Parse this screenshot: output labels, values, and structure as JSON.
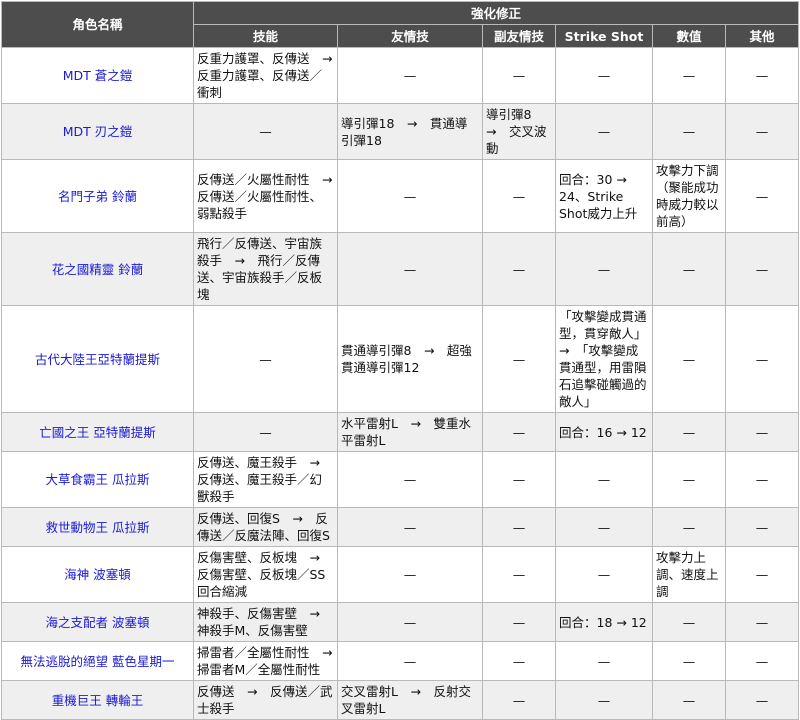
{
  "headers": {
    "name": "角色名稱",
    "group": "強化修正",
    "skill": "技能",
    "friend": "友情技",
    "sub_friend": "副友情技",
    "strike_shot": "Strike Shot",
    "stats": "數值",
    "other": "其他"
  },
  "rows": [
    {
      "name": "MDT 蒼之鎧",
      "skill": "反重力護罩、反傳送　→　反重力護罩、反傳送／衝刺",
      "friend": "—",
      "sub_friend": "—",
      "strike_shot": "—",
      "stats": "—",
      "other": "—"
    },
    {
      "name": "MDT 刃之鎧",
      "skill": "—",
      "friend": "導引彈18　→　貫通導引彈18",
      "sub_friend": "導引彈8　→　交叉波動",
      "strike_shot": "—",
      "stats": "—",
      "other": "—"
    },
    {
      "name": "名門子弟 鈴蘭",
      "skill": "反傳送／火屬性耐性　→　反傳送／火屬性耐性、弱點殺手",
      "friend": "—",
      "sub_friend": "—",
      "strike_shot": "回合：30 → 24、Strike Shot威力上升",
      "stats": "攻擊力下調（聚能成功時威力較以前高）",
      "other": "—"
    },
    {
      "name": "花之國精靈 鈴蘭",
      "skill": "飛行／反傳送、宇宙族殺手　→　飛行／反傳送、宇宙族殺手／反板塊",
      "friend": "—",
      "sub_friend": "—",
      "strike_shot": "—",
      "stats": "—",
      "other": "—"
    },
    {
      "name": "古代大陸王亞特蘭提斯",
      "skill": "—",
      "friend": "貫通導引彈8　→　超強貫通導引彈12",
      "sub_friend": "—",
      "strike_shot": "「攻擊變成貫通型，貫穿敵人」　→　「攻擊變成貫通型，用雷隕石追擊碰觸過的敵人」",
      "stats": "—",
      "other": "—"
    },
    {
      "name": "亡國之王 亞特蘭提斯",
      "skill": "—",
      "friend": "水平雷射L　→　雙重水平雷射L",
      "sub_friend": "—",
      "strike_shot": "回合：16 → 12",
      "stats": "—",
      "other": "—"
    },
    {
      "name": "大草食霸王 瓜拉斯",
      "skill": "反傳送、魔王殺手　→　反傳送、魔王殺手／幻獸殺手",
      "friend": "—",
      "sub_friend": "—",
      "strike_shot": "—",
      "stats": "—",
      "other": "—"
    },
    {
      "name": "救世動物王 瓜拉斯",
      "skill": "反傳送、回復S　→　反傳送／反魔法陣、回復S",
      "friend": "—",
      "sub_friend": "—",
      "strike_shot": "—",
      "stats": "—",
      "other": "—"
    },
    {
      "name": "海神 波塞頓",
      "skill": "反傷害壁、反板塊　→　反傷害壁、反板塊／SS回合縮減",
      "friend": "—",
      "sub_friend": "—",
      "strike_shot": "—",
      "stats": "攻擊力上調、速度上調",
      "other": "—"
    },
    {
      "name": "海之支配者 波塞頓",
      "skill": "神殺手、反傷害壁　→　神殺手M、反傷害壁",
      "friend": "—",
      "sub_friend": "—",
      "strike_shot": "回合：18 → 12",
      "stats": "—",
      "other": "—"
    },
    {
      "name": "無法逃脫的絕望 藍色星期一",
      "skill": "掃雷者／全屬性耐性　→　掃雷者M／全屬性耐性",
      "friend": "—",
      "sub_friend": "—",
      "strike_shot": "—",
      "stats": "—",
      "other": "—"
    },
    {
      "name": "重機巨王 轉輪王",
      "skill": "反傳送　→　反傳送／武士殺手",
      "friend": "交叉雷射L　→　反射交叉雷射L",
      "sub_friend": "—",
      "strike_shot": "—",
      "stats": "—",
      "other": "—"
    }
  ]
}
